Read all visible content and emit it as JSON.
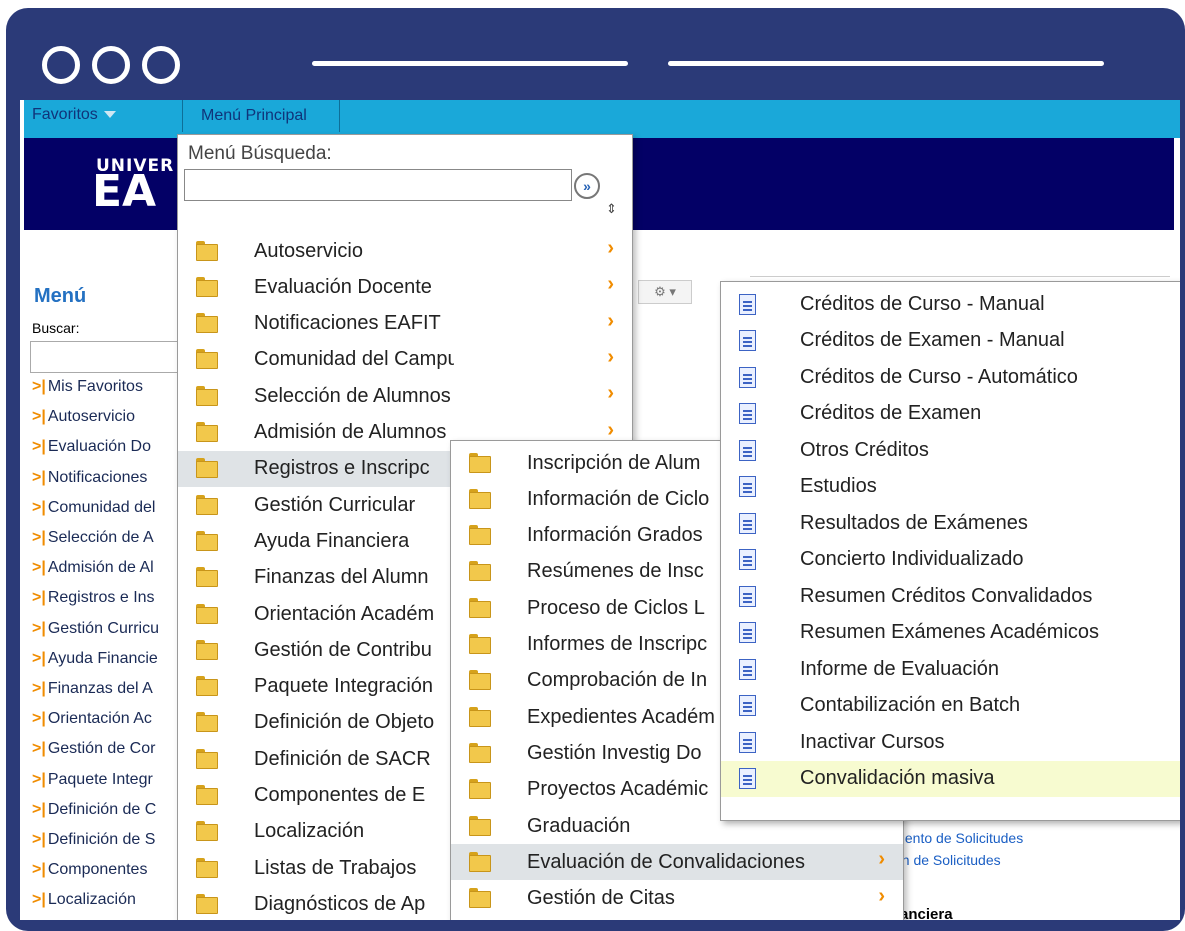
{
  "window": {
    "accent": "#2b3a78"
  },
  "topbar": {
    "favorites_label": "Favoritos",
    "main_menu_tab": "Menú Principal"
  },
  "banner": {
    "logo_line1": "UNIVER",
    "logo_line2": "EA"
  },
  "left_menu": {
    "title": "Menú",
    "search_label": "Buscar:",
    "items": [
      "Mis Favoritos",
      "Autoservicio",
      "Evaluación Do",
      "Notificaciones",
      "Comunidad del",
      "Selección de A",
      "Admisión de Al",
      "Registros e Ins",
      "Gestión Curricu",
      "Ayuda Financie",
      "Finanzas del A",
      "Orientación Ac",
      "Gestión de Cor",
      "Paquete Integr",
      "Definición de C",
      "Definición de S",
      "Componentes",
      "Localización"
    ]
  },
  "background": {
    "links": [
      "niento de Solicitudes",
      "ón de Solicitudes"
    ],
    "bold_text": "anciera"
  },
  "main_menu": {
    "search_title": "Menú Búsqueda:",
    "search_value": "",
    "items": [
      "Autoservicio",
      "Evaluación Docente",
      "Notificaciones EAFIT",
      "Comunidad del Campus",
      "Selección de Alumnos",
      "Admisión de Alumnos",
      "Registros e Inscripc",
      "Gestión Curricular",
      "Ayuda Financiera",
      "Finanzas del Alumn",
      "Orientación Académ",
      "Gestión de Contribu",
      "Paquete Integración",
      "Definición de Objeto",
      "Definición de SACR",
      "Componentes de E",
      "Localización",
      "Listas de Trabajos",
      "Diagnósticos de Ap"
    ]
  },
  "submenu_registros": {
    "items": [
      "Inscripción de Alum",
      "Información de Ciclo",
      "Información Grados",
      "Resúmenes de Insc",
      "Proceso de Ciclos L",
      "Informes de Inscripc",
      "Comprobación de In",
      "Expedientes Académ",
      "Gestión Investig Do",
      "Proyectos Académic",
      "Graduación",
      "Evaluación de Convalidaciones",
      "Gestión de Citas"
    ]
  },
  "submenu_convalidaciones": {
    "items": [
      "Créditos de Curso - Manual",
      "Créditos de Examen - Manual",
      "Créditos de Curso - Automático",
      "Créditos de Examen",
      "Otros Créditos",
      "Estudios",
      "Resultados de Exámenes",
      "Concierto Individualizado",
      "Resumen Créditos Convalidados",
      "Resumen Exámenes Académicos",
      "Informe de Evaluación",
      "Contabilización en Batch",
      "Inactivar Cursos",
      "Convalidación masiva"
    ],
    "highlighted": "Convalidación masiva"
  },
  "icons": {
    "folder": "folder-icon",
    "document": "document-icon",
    "chevron": "chevron-right-icon",
    "go": "go-arrow-icon",
    "gear": "gear-icon"
  }
}
